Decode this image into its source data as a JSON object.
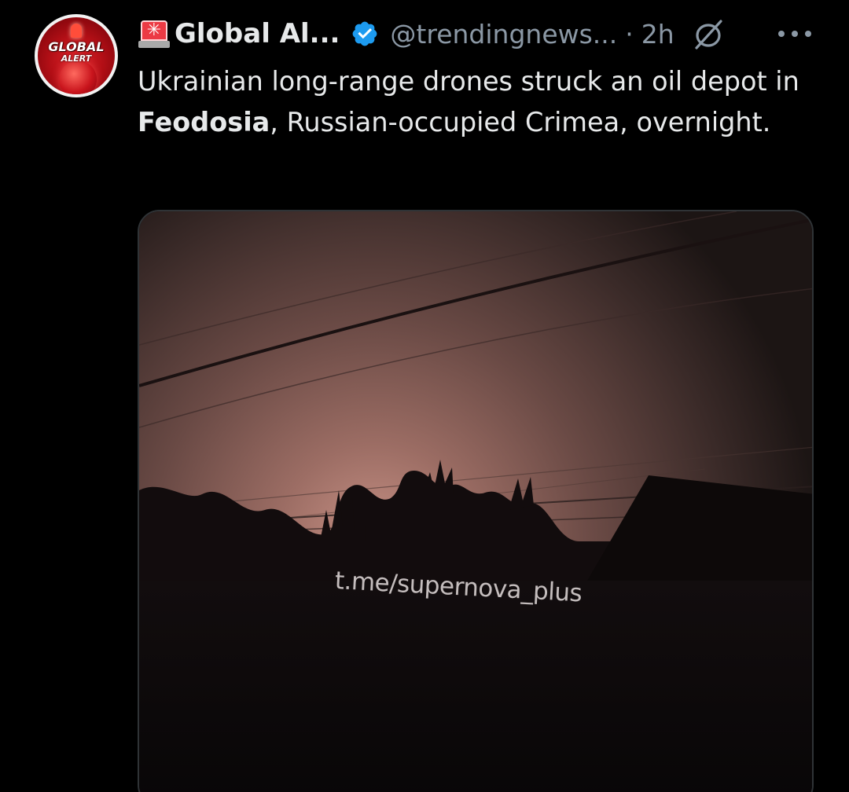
{
  "author": {
    "avatar_logo_text": [
      "GLOBAL",
      "ALERT"
    ],
    "name_emoji": "siren-emoji",
    "display_name": "Global Al...",
    "verified_badge": "verified-icon",
    "handle": "@trendingnews...",
    "separator": "·",
    "timestamp": "2h"
  },
  "icons": {
    "mute": "mute-icon",
    "more": "more-options-icon"
  },
  "tweet": {
    "text_before": "Ukrainian long-range drones struck an oil depot in ",
    "text_bold": "Feodosia",
    "text_after": ", Russian-occupied Crimea, overnight."
  },
  "media": {
    "type": "video",
    "watermark": "t.me/supernova_plus"
  },
  "colors": {
    "background": "#000000",
    "text_primary": "#e7e9ea",
    "text_secondary": "#8b98a5",
    "verified_blue": "#1d9bf0",
    "avatar_red": "#c9141c"
  }
}
